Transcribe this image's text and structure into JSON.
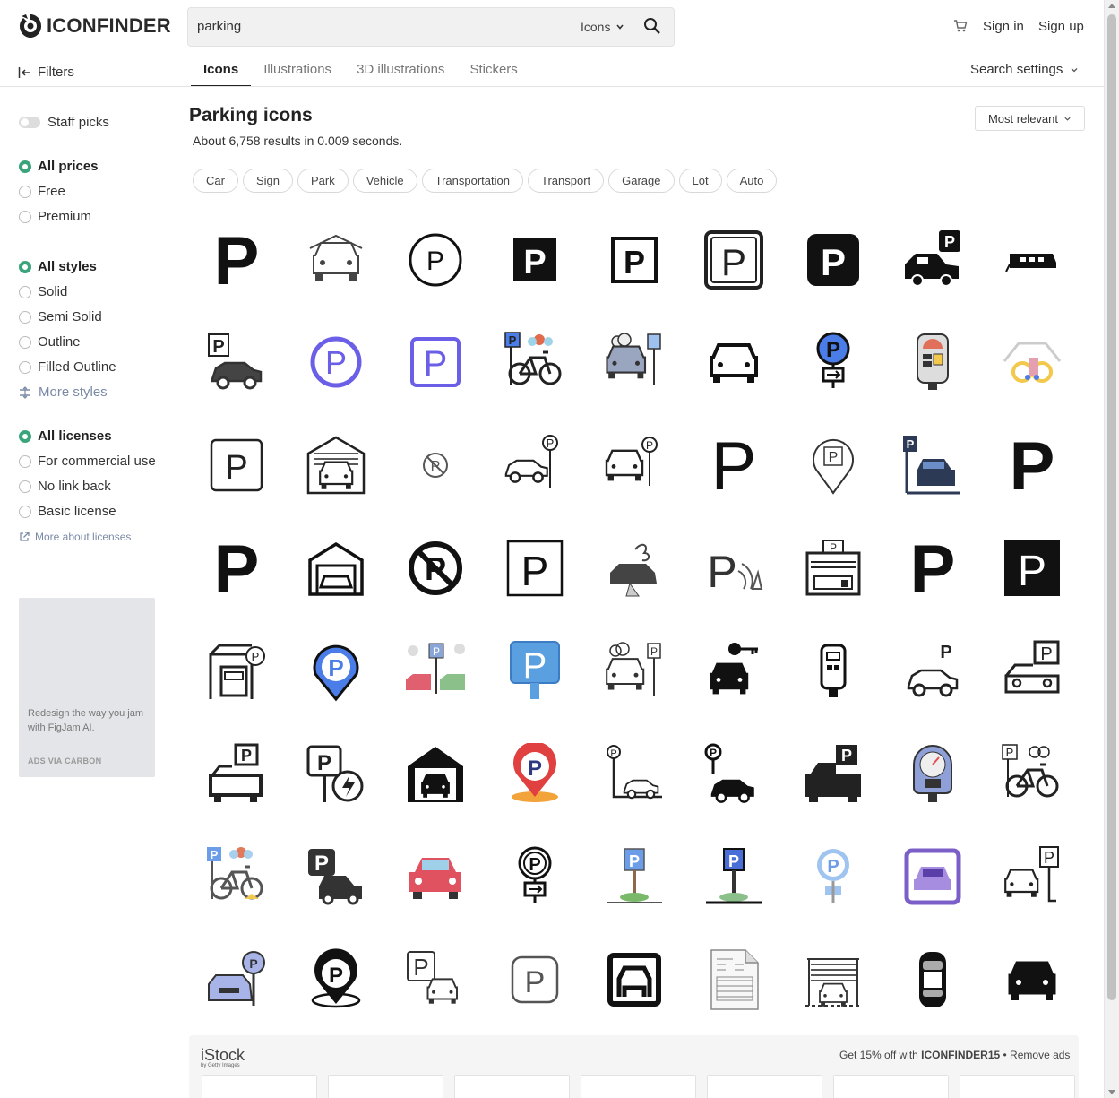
{
  "header": {
    "logo_text": "ICONFINDER",
    "search_value": "parking",
    "search_type": "Icons",
    "sign_in": "Sign in",
    "sign_up": "Sign up"
  },
  "toolbar": {
    "filters_label": "Filters",
    "tabs": [
      "Icons",
      "Illustrations",
      "3D illustrations",
      "Stickers"
    ],
    "active_tab": "Icons",
    "search_settings": "Search settings"
  },
  "sidebar": {
    "staff_picks": "Staff picks",
    "prices": [
      {
        "label": "All prices",
        "selected": true
      },
      {
        "label": "Free",
        "selected": false
      },
      {
        "label": "Premium",
        "selected": false
      }
    ],
    "styles": [
      {
        "label": "All styles",
        "selected": true
      },
      {
        "label": "Solid",
        "selected": false
      },
      {
        "label": "Semi Solid",
        "selected": false
      },
      {
        "label": "Outline",
        "selected": false
      },
      {
        "label": "Filled Outline",
        "selected": false
      }
    ],
    "more_styles": "More styles",
    "licenses": [
      {
        "label": "All licenses",
        "selected": true
      },
      {
        "label": "For commercial use",
        "selected": false
      },
      {
        "label": "No link back",
        "selected": false
      },
      {
        "label": "Basic license",
        "selected": false
      }
    ],
    "more_licenses": "More about licenses",
    "ad_text": "Redesign the way you jam with FigJam AI.",
    "ad_via": "ADS VIA CARBON"
  },
  "main": {
    "title": "Parking icons",
    "results": "About 6,758 results in 0.009 seconds.",
    "sort": "Most relevant",
    "chips": [
      "Car",
      "Sign",
      "Park",
      "Vehicle",
      "Transportation",
      "Transport",
      "Garage",
      "Lot",
      "Auto"
    ]
  },
  "icons": [
    [
      "p-letter-icon",
      "covered-car-icon",
      "p-circle-icon",
      "p-square-solid-icon",
      "p-square-outline-icon",
      "p-rounded-square-icon",
      "p-rounded-solid-icon",
      "car-with-p-sign-icon",
      "tram-icon"
    ],
    [
      "car-p-sign-icon",
      "p-circle-purple-icon",
      "p-square-purple-icon",
      "bike-parking-color-icon",
      "car-parking-cloud-icon",
      "car-front-outline-icon",
      "parking-sign-arrow-icon",
      "parking-meter-color-icon",
      "bike-garage-color-icon"
    ],
    [
      "p-rounded-square-outline-icon",
      "garage-car-icon",
      "no-parking-small-icon",
      "car-side-p-sign-icon",
      "car-meter-icon",
      "p-thin-icon",
      "p-location-pin-icon",
      "car-parking-blue-icon",
      "p-bold-icon"
    ],
    [
      "p-heavy-icon",
      "garage-outline-icon",
      "no-parking-icon",
      "p-square-thin-icon",
      "car-crash-icon",
      "p-sensor-icon",
      "parking-booth-icon",
      "p-black-icon",
      "p-square-black-icon"
    ],
    [
      "gas-station-truck-icon",
      "p-pin-blue-icon",
      "car-parking-scene-icon",
      "p-sign-blue-icon",
      "car-parking-outline-icon",
      "car-key-icon",
      "parking-meter-outline-icon",
      "car-p-outline-icon",
      "car-p-box-icon"
    ],
    [
      "car-front-p-icon",
      "p-ev-charge-icon",
      "garage-solid-icon",
      "p-pin-red-icon",
      "p-sign-car-outline-icon",
      "p-sign-car-solid-icon",
      "car-front-p-solid-icon",
      "parking-meter-gauge-icon",
      "bike-p-outline-icon"
    ],
    [
      "bike-parking-flat-icon",
      "p-car-dark-icon",
      "car-red-icon",
      "parking-sign-arrow-outline-icon",
      "p-sign-grass-icon",
      "p-sign-grass-blue-icon",
      "p-sign-blue-flat-icon",
      "car-purple-square-icon",
      "car-p-sign-outline-icon"
    ],
    [
      "car-meter-purple-icon",
      "p-location-ring-icon",
      "p-car-outline-icon",
      "p-rounded-thin-icon",
      "car-square-icon",
      "invoice-document-icon",
      "garage-shutter-icon",
      "car-top-view-icon",
      "car-front-solid-icon"
    ]
  ],
  "stock": {
    "brand": "iStock",
    "brand_sub": "by Getty Images",
    "promo_prefix": "Get 15% off with ",
    "promo_code": "ICONFINDER15",
    "promo_suffix": " • Remove ads"
  },
  "colors": {
    "accent_green": "#3aa57a",
    "link_blue_gray": "#7a8aa6",
    "purple": "#6b5fe8",
    "blue": "#4a7de8"
  }
}
